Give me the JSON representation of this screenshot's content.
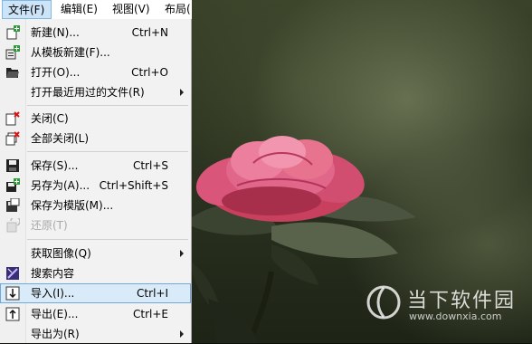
{
  "menubar": {
    "items": [
      {
        "label": "文件(F)",
        "active": true
      },
      {
        "label": "编辑(E)"
      },
      {
        "label": "视图(V)"
      },
      {
        "label": "布局("
      }
    ]
  },
  "file_menu": {
    "items": [
      {
        "label": "新建(N)...",
        "shortcut": "Ctrl+N",
        "icon": "new-file-icon"
      },
      {
        "label": "从模板新建(F)...",
        "shortcut": "",
        "icon": "new-from-template-icon"
      },
      {
        "label": "打开(O)...",
        "shortcut": "Ctrl+O",
        "icon": "open-folder-icon"
      },
      {
        "label": "打开最近用过的文件(R)",
        "shortcut": "",
        "submenu": true
      },
      {
        "label": "关闭(C)",
        "shortcut": "",
        "icon": "close-document-icon"
      },
      {
        "label": "全部关闭(L)",
        "shortcut": "",
        "icon": "close-all-icon"
      },
      {
        "label": "保存(S)...",
        "shortcut": "Ctrl+S",
        "icon": "save-icon"
      },
      {
        "label": "另存为(A)...",
        "shortcut": "Ctrl+Shift+S",
        "icon": "save-as-icon"
      },
      {
        "label": "保存为模版(M)...",
        "shortcut": "",
        "icon": "save-as-template-icon"
      },
      {
        "label": "还原(T)",
        "shortcut": "",
        "icon": "revert-icon",
        "disabled": true
      },
      {
        "label": "获取图像(Q)",
        "shortcut": "",
        "submenu": true
      },
      {
        "label": "搜索内容",
        "shortcut": "",
        "icon": "search-content-icon"
      },
      {
        "label": "导入(I)...",
        "shortcut": "Ctrl+I",
        "icon": "import-icon",
        "highlighted": true
      },
      {
        "label": "导出(E)...",
        "shortcut": "Ctrl+E",
        "icon": "export-icon"
      },
      {
        "label": "导出为(R)",
        "shortcut": "",
        "submenu": true
      }
    ]
  },
  "watermark": {
    "brand": "当下软件园",
    "url": "www.downxia.com"
  },
  "colors": {
    "highlight_bg": "#d9ebf9",
    "highlight_border": "#70a8d8",
    "menu_bg": "#f2f2f2"
  }
}
